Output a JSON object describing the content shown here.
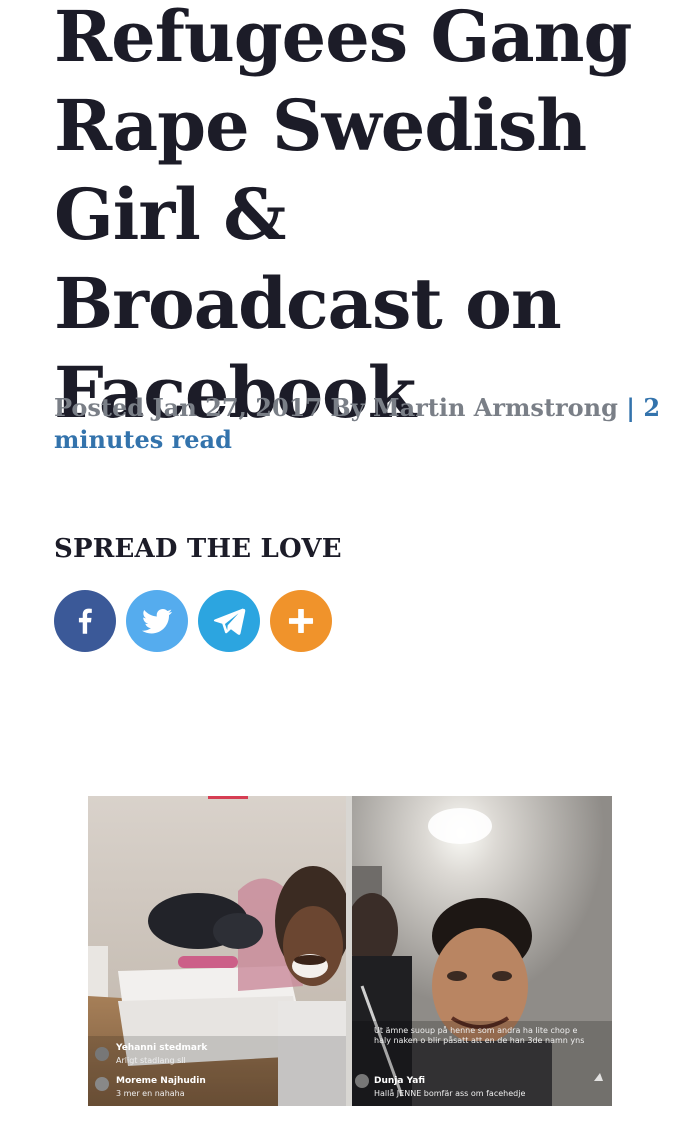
{
  "article": {
    "title": "Refugees Gang Rape Swedish Girl & Broadcast on Facebook",
    "posted_label": "Posted",
    "date": "Jan 27, 2017",
    "by_label": "By",
    "author": "Martin Armstrong",
    "separator": "|",
    "read_time": "2 minutes read"
  },
  "share": {
    "heading": "SPREAD THE LOVE",
    "buttons": [
      {
        "name": "facebook",
        "icon": "facebook-icon",
        "color": "#3b5998"
      },
      {
        "name": "twitter",
        "icon": "twitter-icon",
        "color": "#55acee"
      },
      {
        "name": "telegram",
        "icon": "telegram-icon",
        "color": "#2ca5e0"
      },
      {
        "name": "more",
        "icon": "plus-icon",
        "color": "#f0932b"
      }
    ]
  },
  "image": {
    "left_comments": [
      {
        "name": "Yehanni stedmark",
        "text": "Arligt stadlang sll"
      },
      {
        "name": "Moreme Najhudin",
        "text": "3 mer en nahaha"
      }
    ],
    "right_overlay": "Ut ämne suoup på henne som andra ha lite chop e haly naken o blir påsatt att en de han 3de namn yns",
    "right_comment": {
      "name": "Dunja Yafi",
      "text": "Hallå JENNE bomfär ass om facehedje"
    }
  }
}
